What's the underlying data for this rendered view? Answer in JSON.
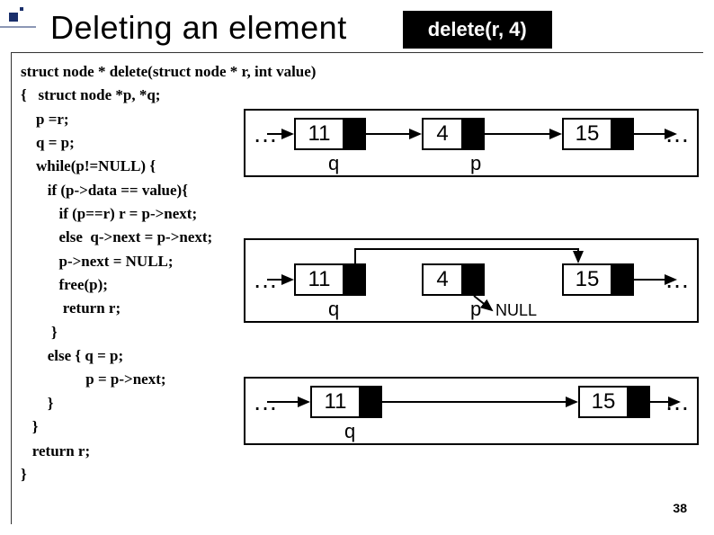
{
  "title": "Deleting an element",
  "callbox": "delete(r, 4)",
  "code": "struct node * delete(struct node * r, int value)\n{   struct node *p, *q;\n    p =r;\n    q = p;\n    while(p!=NULL) {\n       if (p->data == value){\n          if (p==r) r = p->next;\n          else  q->next = p->next;\n          p->next = NULL;\n          free(p);\n           return r;\n        }\n       else { q = p;\n                 p = p->next;\n       }\n   }\n   return r;\n}",
  "diagram1": {
    "dotsL": "…",
    "dotsR": "…",
    "n1": "11",
    "n2": "4",
    "n3": "15",
    "q": "q",
    "p": "p"
  },
  "diagram2": {
    "dotsL": "…",
    "dotsR": "…",
    "n1": "11",
    "n2": "4",
    "n3": "15",
    "q": "q",
    "p": "p",
    "null": "NULL"
  },
  "diagram3": {
    "dotsL": "…",
    "dotsR": "…",
    "n1": "11",
    "n3": "15",
    "q": "q"
  },
  "slide_num": "38"
}
